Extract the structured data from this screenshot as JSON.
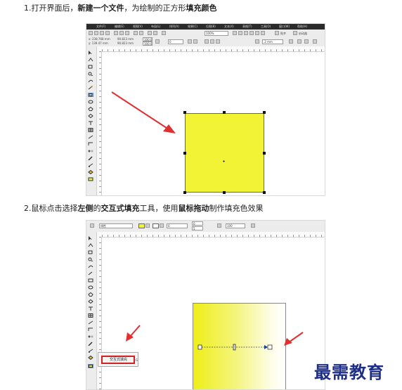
{
  "step1": {
    "prefix": "1.打开界面后，",
    "b1": "新建一个文件",
    "mid": "，为绘制的正方形",
    "b2": "填充颜色"
  },
  "step2": {
    "p1": "2.鼠标点击选择",
    "b1": "左侧",
    "p2": "的",
    "b2": "交互式填充",
    "p3": "工具，使用",
    "b3": "鼠标拖动",
    "p4": "制作填充色效果"
  },
  "shot1": {
    "menu": [
      "文件(F)",
      "编辑(E)",
      "视图(V)",
      "布局(L)",
      "排列(A)",
      "效果(C)",
      "位图(B)",
      "文本(X)",
      "表格(T)",
      "工具(O)",
      "窗口(W)",
      "帮助(H)"
    ],
    "zoom_value": "100%",
    "coords": {
      "x": "x: 238.768 mm",
      "y": "y: 139.47 mm",
      "w": "90.823 mm",
      "h": "90.823 mm"
    },
    "scale_w": "100.0",
    "scale_h": "100.0",
    "angle": "0",
    "outline_width": ".2 mm",
    "snap_label": "贴齐",
    "launch_label": "启动器"
  },
  "shot2": {
    "fill_type": "线性",
    "midpoint": "0",
    "angle_value": "0",
    "edge_pad": "5",
    "percent": "100",
    "popup_label": "交互式填充",
    "popup_shortcut": "G"
  },
  "watermark": "最需教育",
  "colors": {
    "fill_yellow": "#f3f336",
    "arrow_red": "#e03030",
    "highlight_red": "#d42020",
    "watermark_blue": "#1e2e86"
  }
}
